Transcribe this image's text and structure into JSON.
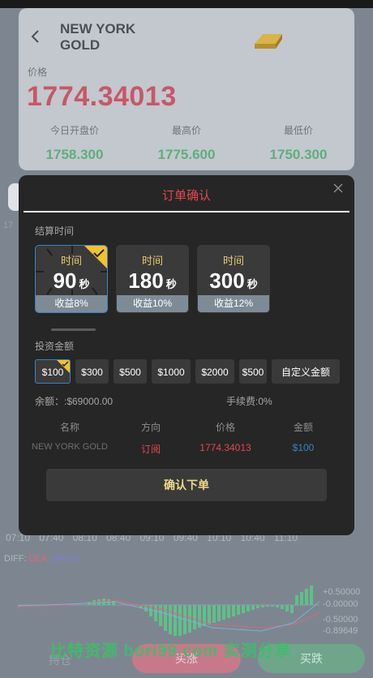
{
  "header": {
    "symbol": "NEW YORK GOLD",
    "price_label": "价格",
    "price": "1774.34013",
    "stats": [
      {
        "label": "今日开盘价",
        "value": "1758.300"
      },
      {
        "label": "最高价",
        "value": "1775.600"
      },
      {
        "label": "最低价",
        "value": "1750.300"
      }
    ]
  },
  "background": {
    "time_axis": "07:10 07:40 08:10 08:40 09:10 09:40 10:10 10:40 11:10",
    "diff": "DIFF:",
    "dea": "DEA:",
    "macd": "MACD:",
    "macd_axis": [
      "+0.50000",
      "-0.00000",
      "-0.50000",
      "-0.89649"
    ],
    "watermark": "比特资源 bori99.com 实测分享",
    "bottom": {
      "hold": "持仓",
      "buy_up": "买涨",
      "buy_down": "买跌"
    }
  },
  "modal": {
    "title": "订单确认",
    "settle_label": "结算时间",
    "periods": [
      {
        "time_label": "时间",
        "seconds": "90",
        "unit": "秒",
        "rate": "收益8%",
        "selected": true
      },
      {
        "time_label": "时间",
        "seconds": "180",
        "unit": "秒",
        "rate": "收益10%",
        "selected": false
      },
      {
        "time_label": "时间",
        "seconds": "300",
        "unit": "秒",
        "rate": "收益12%",
        "selected": false
      }
    ],
    "amount_label": "投资金额",
    "amounts": [
      "$100",
      "$300",
      "$500",
      "$1000",
      "$2000",
      "$500"
    ],
    "custom_amount": "自定义金额",
    "balance": "余额：:$69000.00",
    "fee": "手续费:0%",
    "table_headers": [
      "名称",
      "方向",
      "价格",
      "金额"
    ],
    "table_row": {
      "name": "NEW YORK GOLD",
      "direction": "订阅",
      "price": "1774.34013",
      "amount": "$100"
    },
    "confirm": "确认下单"
  },
  "colors": {
    "price_red": "#c85768",
    "stat_green": "#5fae7d",
    "modal_bg": "#262626",
    "title_red": "#e5474f",
    "select_blue": "#3a82c6",
    "badge_yellow": "#f2c12e",
    "confirm_text": "#f0d788"
  }
}
